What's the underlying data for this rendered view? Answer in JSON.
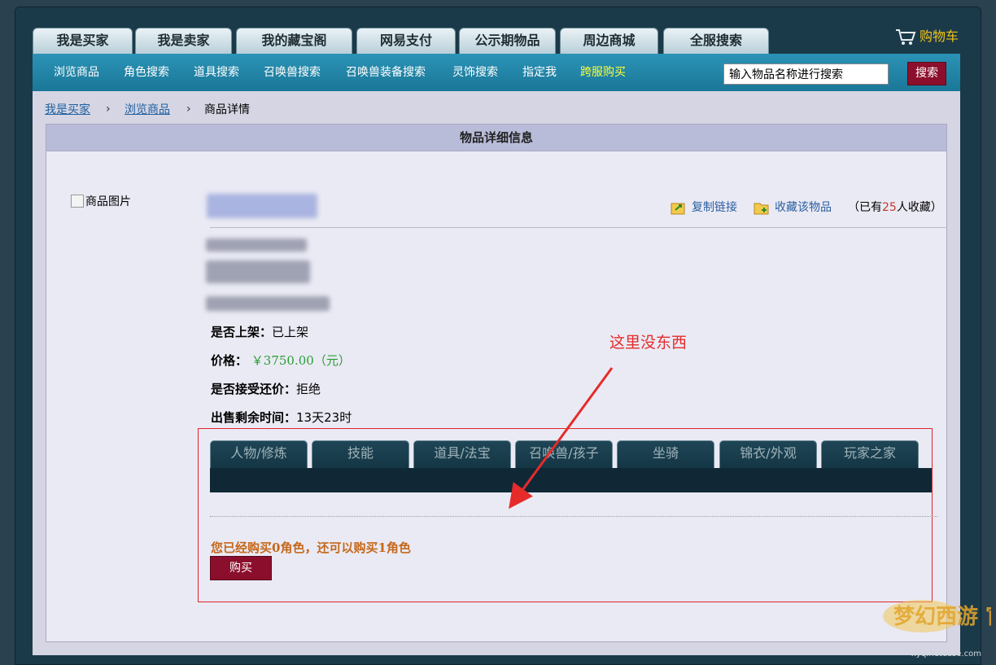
{
  "top_tabs": [
    "我是买家",
    "我是卖家",
    "我的藏宝阁",
    "网易支付",
    "公示期物品",
    "周边商城",
    "全服搜索"
  ],
  "cart": {
    "label": "购物车",
    "icon": "cart-icon"
  },
  "nav": {
    "items": [
      "浏览商品",
      "角色搜索",
      "道具搜索",
      "召唤兽搜索",
      "召唤兽装备搜索",
      "灵饰搜索",
      "指定我",
      "跨服购买"
    ]
  },
  "search": {
    "value": "输入物品名称进行搜索",
    "button": "搜索"
  },
  "breadcrumb": {
    "items": [
      "我是买家",
      "浏览商品",
      "商品详情"
    ]
  },
  "panel": {
    "title": "物品详细信息"
  },
  "item": {
    "image_alt": "商品图片",
    "copy_link": "复制链接",
    "favorite": "收藏该物品",
    "fav_prefix": "（已有",
    "fav_count": "25",
    "fav_suffix": "人收藏）",
    "listed_label": "是否上架：",
    "listed_value": "已上架",
    "price_label": "价格：",
    "price_value": "￥3750.00（元）",
    "bargain_label": "是否接受还价：",
    "bargain_value": "拒绝",
    "time_label": "出售剩余时间：",
    "time_value": "13天23时"
  },
  "detail_tabs": [
    "人物/修炼",
    "技能",
    "道具/法宝",
    "召唤兽/孩子",
    "坐骑",
    "锦衣/外观",
    "玩家之家"
  ],
  "purchase": {
    "info": "您已经购买0角色，还可以购买1角色",
    "button": "购买"
  },
  "annotation": {
    "text": "这里没东西",
    "color": "#e62b2b"
  },
  "watermark": {
    "text": "梦幻西游 官方论坛",
    "url_text": "xyq.netease.com"
  }
}
